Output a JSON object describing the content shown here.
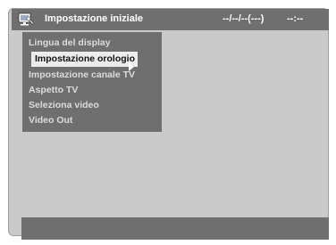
{
  "header": {
    "title": "Impostazione iniziale",
    "date": "--/--/--(---)",
    "time": "--:--",
    "icon": "setup-screen-icon"
  },
  "menu": {
    "items": [
      {
        "label": "Lingua del display",
        "selected": false
      },
      {
        "label": "Impostazione orologio",
        "selected": true
      },
      {
        "label": "Impostazione canale TV",
        "selected": false
      },
      {
        "label": "Aspetto TV",
        "selected": false
      },
      {
        "label": "Seleziona video",
        "selected": false
      },
      {
        "label": "Video Out",
        "selected": false
      }
    ],
    "submenu_indicator": "right-arrow-icon"
  },
  "colors": {
    "screen_background": "#cacaca",
    "bar": "#6f6f6f",
    "highlight": "#ececec",
    "text_light": "#dcdcdc",
    "text_dark": "#111111"
  }
}
